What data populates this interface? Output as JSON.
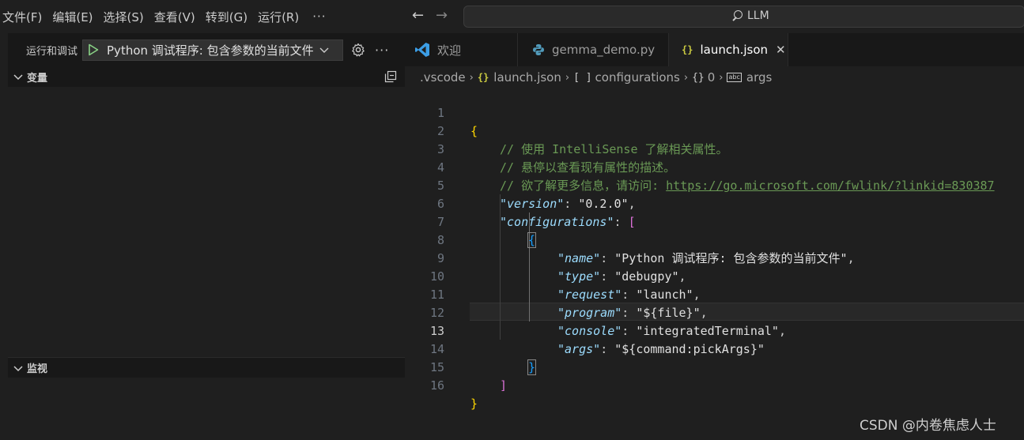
{
  "menu": {
    "items": [
      "文件(F)",
      "编辑(E)",
      "选择(S)",
      "查看(V)",
      "转到(G)",
      "运行(R)"
    ],
    "more": "···"
  },
  "command_center": {
    "text": "LLM"
  },
  "debug": {
    "title": "运行和调试",
    "config": "Python 调试程序: 包含参数的当前文件"
  },
  "sections": {
    "variables": "变量",
    "watch": "监视"
  },
  "tabs": [
    {
      "label": "欢迎",
      "icon": "vscode-logo-icon"
    },
    {
      "label": "gemma_demo.py",
      "icon": "python-icon"
    },
    {
      "label": "launch.json",
      "icon": "json-icon",
      "active": true
    }
  ],
  "breadcrumb": {
    "folder": ".vscode",
    "file": "launch.json",
    "configurations": "configurations",
    "index": "0",
    "args": "args"
  },
  "code": {
    "line_numbers": [
      "1",
      "2",
      "3",
      "4",
      "5",
      "6",
      "7",
      "8",
      "9",
      "10",
      "11",
      "12",
      "13",
      "14",
      "15",
      "16"
    ],
    "current_line": 13,
    "comment1": "// 使用 IntelliSense 了解相关属性。",
    "comment2": "// 悬停以查看现有属性的描述。",
    "comment3_prefix": "// 欲了解更多信息，请访问: ",
    "comment3_link": "https://go.microsoft.com/fwlink/?linkid=830387",
    "version_key": "\"version\"",
    "version_val": "\"0.2.0\"",
    "configurations_key": "\"configurations\"",
    "name_key": "\"name\"",
    "name_val": "\"Python 调试程序: 包含参数的当前文件\"",
    "type_key": "\"type\"",
    "type_val": "\"debugpy\"",
    "request_key": "\"request\"",
    "request_val": "\"launch\"",
    "program_key": "\"program\"",
    "program_val": "\"${file}\"",
    "console_key": "\"console\"",
    "console_val": "\"integratedTerminal\"",
    "args_key": "\"args\"",
    "args_val": "\"${command:pickArgs}\""
  },
  "watermark": "CSDN @内卷焦虑人士",
  "colors": {
    "accent_play": "#89d185",
    "json_icon": "#cbcb41",
    "key": "#9cdcfe",
    "comment": "#6a9955"
  }
}
